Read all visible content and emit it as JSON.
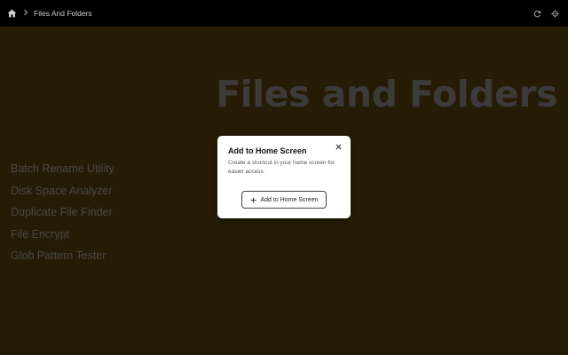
{
  "breadcrumb": {
    "home_icon": "home-icon",
    "separator_icon": "chevron-right-icon",
    "current": "Files And Folders"
  },
  "toolbar": {
    "icons": [
      "refresh-icon",
      "gear-icon"
    ]
  },
  "main": {
    "title": "Files and Folders",
    "tools": [
      "Batch Rename Utility",
      "Disk Space Analyzer",
      "Duplicate File Finder",
      "File Encrypt",
      "Glob Pattern Tester"
    ]
  },
  "dialog": {
    "title": "Add to Home Screen",
    "description": "Create a shortcut in your home screen for easier access.",
    "close_icon": "close-icon",
    "action_icon": "plus-icon",
    "action_label": "Add to Home Screen"
  },
  "colors": {
    "background": "#261c06",
    "topbar": "#000000",
    "title_text": "#3c3b3a",
    "list_text": "#4a4843",
    "dialog_bg": "#ffffff"
  }
}
